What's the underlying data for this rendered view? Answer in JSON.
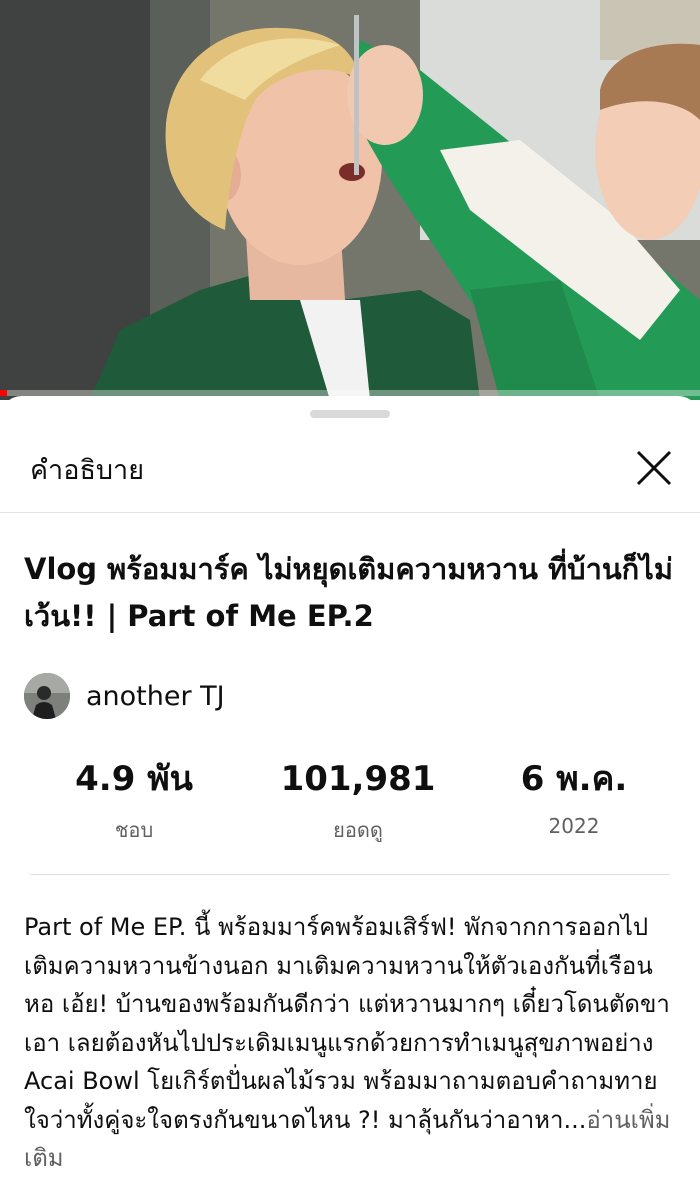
{
  "video": {
    "progress_fraction": 0.01,
    "accent_color": "#ff0000"
  },
  "sheet": {
    "title": "คำอธิบาย",
    "close_icon": "close-icon"
  },
  "details": {
    "title": "Vlog พร้อมมาร์ค ไม่หยุดเติมความหวาน ที่บ้านก็ไม่เว้น!! | Part of Me EP.2",
    "channel_name": "another TJ",
    "stats": [
      {
        "value": "4.9 พัน",
        "label": "ชอบ"
      },
      {
        "value": "101,981",
        "label": "ยอดดู"
      },
      {
        "value": "6 พ.ค.",
        "label": "2022"
      }
    ],
    "description": "Part of Me EP. นี้ พร้อมมาร์คพร้อมเสิร์ฟ! พักจากการออกไปเติมความหวานข้างนอก มาเติมความหวานให้ตัวเองกันที่เรือนหอ เอ้ย! บ้านของพร้อมกันดีกว่า แต่หวานมากๆ เดี๋ยวโดนตัดขาเอา เลยต้องหันไปประเดิมเมนูแรกด้วยการทำเมนูสุขภาพอย่าง Acai Bowl โยเกิร์ตปั่นผลไม้รวม พร้อมมาถามตอบคำถามทายใจว่าทั้งคู่จะใจตรงกันขนาดไหน ?! มาลุ้นกันว่าอาหา...",
    "read_more": "อ่านเพิ่มเติม"
  }
}
